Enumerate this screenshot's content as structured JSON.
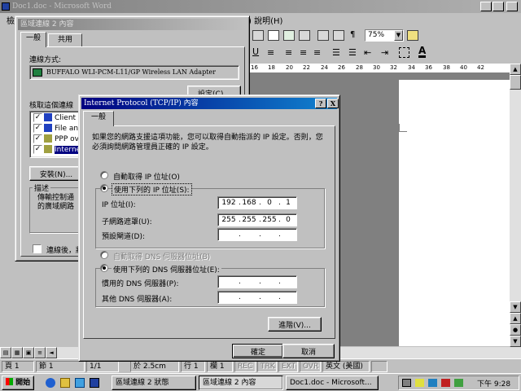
{
  "word": {
    "title": "Doc1.doc - Microsoft Word",
    "menu_fragment": ") 說明(H)",
    "left_menu_fragment": "檢",
    "left_tb_fragment": "內",
    "zoom": "75%",
    "ruler_ticks": [
      "16",
      "18",
      "20",
      "22",
      "24",
      "26",
      "28",
      "30",
      "32",
      "34",
      "36",
      "38",
      "40",
      "42"
    ],
    "status": {
      "page": "頁 1",
      "section": "節 1",
      "page_of": "1/1",
      "position": "於 2.5cm",
      "line": "行 1",
      "col": "欄 1",
      "rec": "REC",
      "trk": "TRK",
      "ext": "EXT",
      "ovr": "OVR",
      "lang": "英文 (美國)"
    }
  },
  "lan_dialog": {
    "title": "區域連線 2 內容",
    "tabs": [
      "一般",
      "共用"
    ],
    "connect_using_label": "連線方式:",
    "adapter": "BUFFALO WLI-PCM-L11/GP Wireless LAN Adapter",
    "configure_button": "設定(C)...",
    "components_label": "核取這個連線",
    "components": [
      "Client f",
      "File and",
      "PPP ove",
      "Internet"
    ],
    "install_button": "安裝(N)...",
    "description_label": "描述",
    "description_text": "傳輸控制通\n的廣域網路",
    "show_icon_label": "連線後，將"
  },
  "tcp_dialog": {
    "title": "Internet Protocol (TCP/IP) 內容",
    "help_btn": "?",
    "close_btn": "X",
    "tab": "一般",
    "intro": "如果您的網路支援這項功能，您可以取得自動指派的 IP 設定。否則，您必須詢問網路管理員正確的 IP 設定。",
    "auto_ip": "自動取得 IP 位址(O)",
    "use_ip": "使用下列的 IP 位址(S):",
    "ip_label": "IP 位址(I):",
    "ip_value": [
      "192",
      "168",
      "0",
      "1"
    ],
    "mask_label": "子網路遮罩(U):",
    "mask_value": [
      "255",
      "255",
      "255",
      "0"
    ],
    "gateway_label": "預設閘道(D):",
    "auto_dns": "自動取得 DNS 伺服器位址(B)",
    "use_dns": "使用下列的 DNS 伺服器位址(E):",
    "preferred_dns": "慣用的 DNS 伺服器(P):",
    "alternate_dns": "其他 DNS 伺服器(A):",
    "advanced_button": "進階(V)...",
    "ok_button": "確定",
    "cancel_button": "取消"
  },
  "taskbar": {
    "start": "開始",
    "tasks": [
      "區域連線 2 狀態",
      "區域連線 2 內容",
      "Doc1.doc - Microsoft..."
    ],
    "clock": "下午 9:28"
  }
}
